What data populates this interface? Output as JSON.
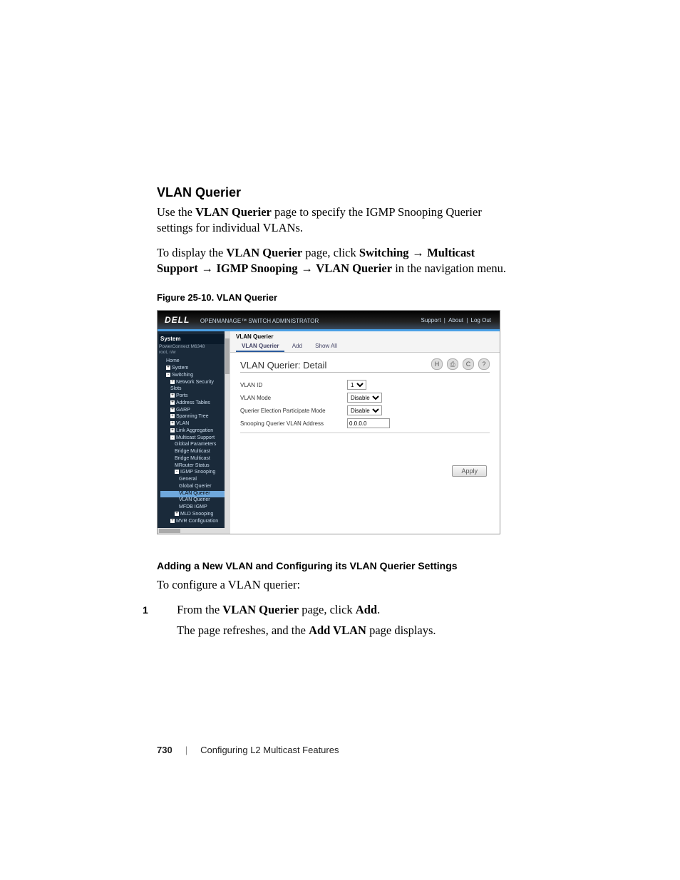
{
  "section_title": "VLAN Querier",
  "intro": [
    "Use the ",
    "VLAN Querier",
    " page to specify the IGMP Snooping Querier settings for individual VLANs."
  ],
  "nav_instr": {
    "pre": "To display the ",
    "bold1": "VLAN Querier",
    "mid1": " page, click ",
    "bold2": "Switching",
    "arr": " → ",
    "bold3": "Multicast Support",
    "bold4": "IGMP Snooping",
    "bold5": "VLAN Querier",
    "tail": " in the navigation menu."
  },
  "figure_caption": "Figure 25-10.    VLAN Querier",
  "screenshot": {
    "brand": "DELL",
    "admin_title": "OPENMANAGE™ SWITCH ADMINISTRATOR",
    "top_links": [
      "Support",
      "About",
      "Log Out"
    ],
    "side_header": "System",
    "side_sub1": "PowerConnect M6348",
    "side_sub2": "root, r/w",
    "tree": [
      {
        "label": "Home",
        "box": ""
      },
      {
        "label": "System",
        "box": "+"
      },
      {
        "label": "Switching",
        "box": "-"
      },
      {
        "label": "Network Security",
        "box": "+",
        "indent": 1
      },
      {
        "label": "Slots",
        "box": "",
        "indent": 1
      },
      {
        "label": "Ports",
        "box": "+",
        "indent": 1
      },
      {
        "label": "Address Tables",
        "box": "+",
        "indent": 1
      },
      {
        "label": "GARP",
        "box": "+",
        "indent": 1
      },
      {
        "label": "Spanning Tree",
        "box": "+",
        "indent": 1
      },
      {
        "label": "VLAN",
        "box": "+",
        "indent": 1
      },
      {
        "label": "Link Aggregation",
        "box": "+",
        "indent": 1
      },
      {
        "label": "Multicast Support",
        "box": "-",
        "indent": 1
      },
      {
        "label": "Global Parameters",
        "box": "",
        "indent": 2
      },
      {
        "label": "Bridge Multicast",
        "box": "",
        "indent": 2
      },
      {
        "label": "Bridge Multicast",
        "box": "",
        "indent": 2
      },
      {
        "label": "MRouter Status",
        "box": "",
        "indent": 2
      },
      {
        "label": "IGMP Snooping",
        "box": "-",
        "indent": 2
      },
      {
        "label": "General",
        "box": "",
        "indent": 3
      },
      {
        "label": "Global Querier",
        "box": "",
        "indent": 3
      },
      {
        "label": "VLAN Querier",
        "box": "",
        "indent": 3,
        "sel": true
      },
      {
        "label": "VLAN Querier",
        "box": "",
        "indent": 3
      },
      {
        "label": "MFDB IGMP",
        "box": "",
        "indent": 3
      },
      {
        "label": "MLD Snooping",
        "box": "+",
        "indent": 2
      },
      {
        "label": "MVR Configuration",
        "box": "+",
        "indent": 1
      }
    ],
    "crumb": "VLAN Querier",
    "tabs": [
      "VLAN Querier",
      "Add",
      "Show All"
    ],
    "panel_title": "VLAN Querier: Detail",
    "toolbar_icons": [
      "save-icon",
      "print-icon",
      "refresh-icon",
      "help-icon"
    ],
    "toolbar_glyphs": [
      "H",
      "⎙",
      "C",
      "?"
    ],
    "form": [
      {
        "label": "VLAN ID",
        "type": "select",
        "options": [
          "1"
        ]
      },
      {
        "label": "VLAN Mode",
        "type": "select",
        "options": [
          "Disable"
        ]
      },
      {
        "label": "Querier Election Participate Mode",
        "type": "select",
        "options": [
          "Disable"
        ]
      },
      {
        "label": "Snooping Querier VLAN Address",
        "type": "input",
        "value": "0.0.0.0"
      }
    ],
    "apply": "Apply"
  },
  "sub_heading": "Adding a New VLAN and Configuring its VLAN Querier Settings",
  "configure_line": "To configure a VLAN querier:",
  "step1": {
    "pre": "From the ",
    "bold1": "VLAN Querier",
    "mid": " page, click ",
    "bold2": "Add",
    "tail": ".",
    "cont_pre": "The page refreshes, and the ",
    "cont_bold": "Add VLAN",
    "cont_tail": " page displays."
  },
  "footer": {
    "page": "730",
    "chapter": "Configuring L2 Multicast Features"
  }
}
